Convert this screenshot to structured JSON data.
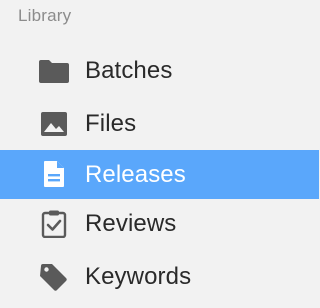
{
  "sidebar": {
    "section_title": "Library",
    "selected_item": "Releases",
    "items": [
      {
        "label": "Batches",
        "icon": "folder-icon",
        "selected": false
      },
      {
        "label": "Files",
        "icon": "image-icon",
        "selected": false
      },
      {
        "label": "Releases",
        "icon": "document-icon",
        "selected": true
      },
      {
        "label": "Reviews",
        "icon": "clipboard-check-icon",
        "selected": false
      },
      {
        "label": "Keywords",
        "icon": "tag-icon",
        "selected": false
      }
    ]
  },
  "colors": {
    "background": "#f2f2f2",
    "selection": "#5aa7fb",
    "icon": "#5a5a5a",
    "text": "#2a2a2a",
    "header_text": "#8c8c8c"
  }
}
